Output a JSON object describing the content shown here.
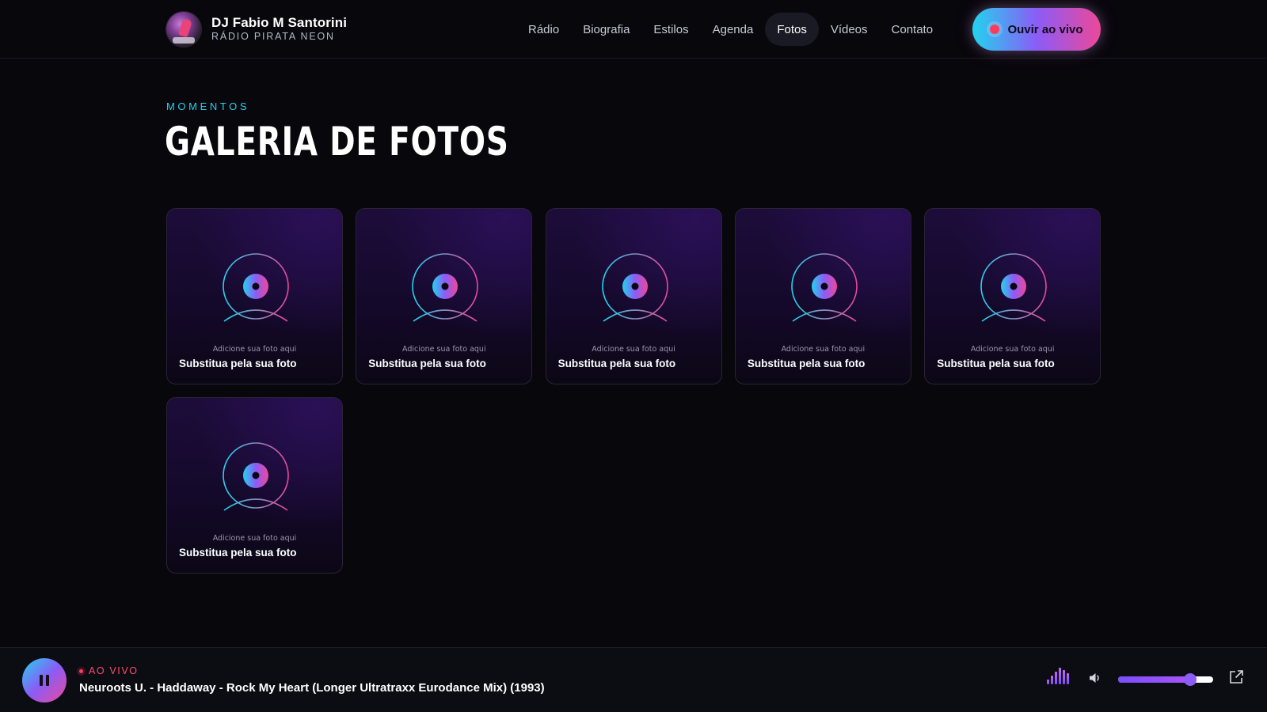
{
  "brand": {
    "name": "DJ Fabio M Santorini",
    "subtitle": "RÁDIO PIRATA NEON"
  },
  "nav": {
    "items": [
      {
        "label": "Rádio",
        "active": false
      },
      {
        "label": "Biografia",
        "active": false
      },
      {
        "label": "Estilos",
        "active": false
      },
      {
        "label": "Agenda",
        "active": false
      },
      {
        "label": "Fotos",
        "active": true
      },
      {
        "label": "Vídeos",
        "active": false
      },
      {
        "label": "Contato",
        "active": false
      }
    ],
    "cta_label": "Ouvir ao vivo"
  },
  "section": {
    "eyebrow": "MOMENTOS",
    "title": "GALERIA DE FOTOS"
  },
  "gallery": {
    "cards": [
      {
        "hint": "Adicione sua foto aqui",
        "caption": "Substitua pela sua foto"
      },
      {
        "hint": "Adicione sua foto aqui",
        "caption": "Substitua pela sua foto"
      },
      {
        "hint": "Adicione sua foto aqui",
        "caption": "Substitua pela sua foto"
      },
      {
        "hint": "Adicione sua foto aqui",
        "caption": "Substitua pela sua foto"
      },
      {
        "hint": "Adicione sua foto aqui",
        "caption": "Substitua pela sua foto"
      },
      {
        "hint": "Adicione sua foto aqui",
        "caption": "Substitua pela sua foto"
      }
    ]
  },
  "player": {
    "status": "AO VIVO",
    "track": "Neuroots U. - Haddaway - Rock My Heart (Longer Ultratraxx Eurodance Mix) (1993)",
    "volume_percent": 76
  },
  "colors": {
    "background": "#07070c",
    "accent_cyan": "#22d3ee",
    "accent_violet": "#8b5cf6",
    "accent_pink": "#ec4899",
    "live_red": "#ff3b5c"
  },
  "icons": {
    "player_button": "pause-icon",
    "equalizer": "equalizer-icon",
    "volume": "volume-icon",
    "popout": "external-link-icon",
    "placeholder": "vinyl-disc-icon"
  }
}
